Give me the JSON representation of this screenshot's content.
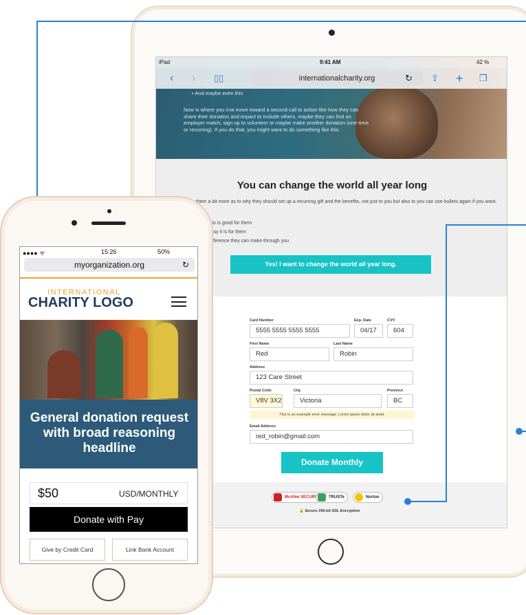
{
  "ipad": {
    "status": {
      "device": "iPad",
      "time": "9:41 AM",
      "battery": "42 %"
    },
    "url": "internationalcharity.org",
    "hero": {
      "bullet": "• And maybe even this",
      "text": "Now is where you cna move toward a second call to action like how they can share their donation and impact to include others, maybe they can find an employer match, sign up to volunteer or maybe make another donation (one-time or recurring). If you do that, you might want to do something like this."
    },
    "heading": "You can change the world all year long",
    "paragraph": "them a bit more as to why they should set up a recurring gift and the benefits, not just to you but also to you can use bullets again if you want.",
    "bullets": [
      "this is good for them",
      "easy it is for them",
      "difference they can make through you"
    ],
    "cta": "Yes! I want to change the world all year long.",
    "form": {
      "card_number_label": "Card Number",
      "card_number": "5555 5555 5555 5555",
      "exp_label": "Exp. Date",
      "exp": "04/17",
      "cvv_label": "CVV",
      "cvv": "604",
      "first_label": "First Name",
      "first": "Red",
      "last_label": "Last Name",
      "last": "Robin",
      "address_label": "Address",
      "address": "123 Care Street",
      "postal_label": "Postal Code",
      "postal": "V8V 3X2",
      "city_label": "City",
      "city": "Victoria",
      "province_label": "Province",
      "province": "BC",
      "error": "This is an example error message. Lorem ipsum dolor sit amet.",
      "email_label": "Email Address",
      "email": "red_robin@gmail.com",
      "submit": "Donate Monthly"
    },
    "trust": {
      "mcafee": "McAfee SECURE",
      "truste": "TRUSTe",
      "norton": "Norton",
      "ssl": "Secure 256-bit SSL Encryption"
    }
  },
  "iphone": {
    "status": {
      "time": "15:26",
      "battery": "50%"
    },
    "url": "myorganization.org",
    "logo_top": "INTERNATIONAL",
    "logo_main": "CHARITY LOGO",
    "headline": "General donation request with broad reasoning headline",
    "amount": "$50",
    "currency": "USD/MONTHLY",
    "apple_pay": "Donate with  Pay",
    "credit_card": "Give by Credit Card",
    "bank": "Link Bank Account"
  }
}
